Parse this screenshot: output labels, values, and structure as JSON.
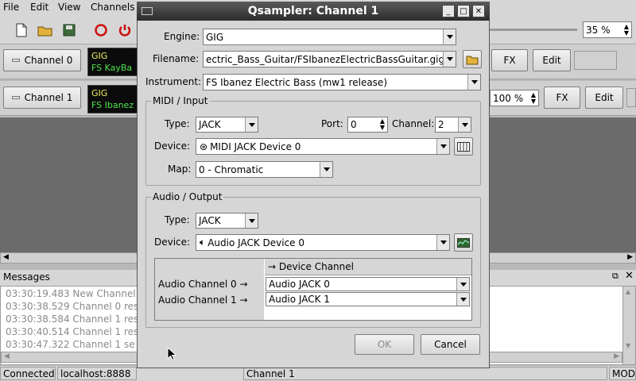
{
  "menubar": {
    "items": [
      "File",
      "Edit",
      "View",
      "Channels"
    ]
  },
  "toolbar": {
    "zoom": "35 %"
  },
  "strips": [
    {
      "label": "Channel 0",
      "engine": "GIG",
      "instrument": "FS KayBa",
      "fx": "FX",
      "edit": "Edit"
    },
    {
      "label": "Channel 1",
      "engine": "GIG",
      "instrument": "FS Ibanez",
      "volume": "100 %",
      "fx": "FX",
      "edit": "Edit"
    }
  ],
  "messages": {
    "title": "Messages",
    "lines": [
      "03:30:19.483 New Channel",
      "03:30:38.529 Channel 0 res",
      "03:30:38.584 Channel 1 res",
      "03:30:40.514 Channel 1 res",
      "03:30:47.322 Channel 1 se"
    ]
  },
  "statusbar": {
    "connection": "Connected",
    "host": "localhost:8888",
    "channel": "Channel 1",
    "mode": "MOD"
  },
  "dialog": {
    "title": "Qsampler: Channel 1",
    "engine_label": "Engine:",
    "engine_value": "GIG",
    "filename_label": "Filename:",
    "filename_value": "ectric_Bass_Guitar/FSIbanezElectricBassGuitar.gig",
    "instrument_label": "Instrument:",
    "instrument_value": "FS Ibanez Electric Bass (mw1 release)",
    "midi": {
      "title": "MIDI / Input",
      "type_label": "Type:",
      "type_value": "JACK",
      "port_label": "Port:",
      "port_value": "0",
      "channel_label": "Channel:",
      "channel_value": "2",
      "device_label": "Device:",
      "device_value": "MIDI JACK Device 0",
      "map_label": "Map:",
      "map_value": "0 - Chromatic"
    },
    "audio": {
      "title": "Audio / Output",
      "type_label": "Type:",
      "type_value": "JACK",
      "device_label": "Device:",
      "device_value": "Audio JACK Device 0",
      "grid_header": "→ Device Channel",
      "rows": [
        {
          "label": "Audio Channel 0 →",
          "value": "Audio JACK 0"
        },
        {
          "label": "Audio Channel 1 →",
          "value": "Audio JACK 1"
        }
      ]
    },
    "ok_label": "OK",
    "cancel_label": "Cancel"
  }
}
